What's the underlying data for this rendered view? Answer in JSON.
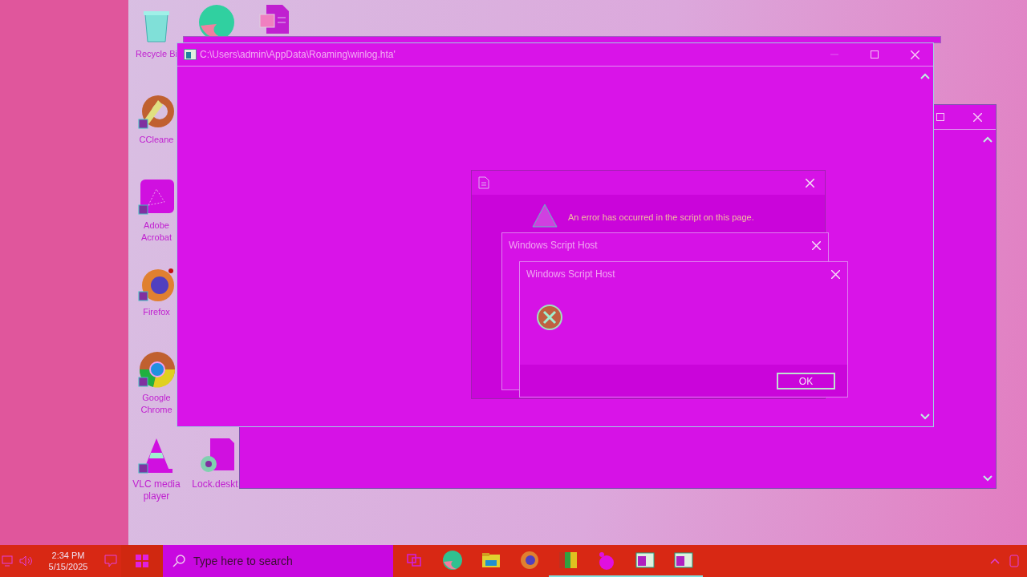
{
  "desktop_icons": [
    {
      "kind": "recycle",
      "label": "Recycle Bi"
    },
    {
      "kind": "edge"
    },
    {
      "kind": "word"
    },
    {
      "kind": "ccleaner",
      "label": "CCleane"
    },
    {
      "kind": "acrobat",
      "label": "Adobe Acrobat"
    },
    {
      "kind": "firefox",
      "label": "Firefox"
    },
    {
      "kind": "chrome",
      "label": "Google Chrome"
    },
    {
      "kind": "vlc",
      "label": "VLC media player"
    },
    {
      "kind": "file",
      "label": "Lock.deskt"
    }
  ],
  "back_window": {
    "buttons": [
      {
        "kind": "maximize",
        "disabled": false
      },
      {
        "kind": "close",
        "disabled": false
      }
    ]
  },
  "main_window": {
    "title": "C:\\Users\\admin\\AppData\\Roaming\\winlog.hta'",
    "buttons": [
      {
        "kind": "minimize",
        "disabled": true
      },
      {
        "kind": "maximize",
        "disabled": false
      },
      {
        "kind": "close",
        "disabled": false
      }
    ]
  },
  "dialogs": [
    {
      "kind": "script_error",
      "message": "An error has occurred in the script on this page."
    },
    {
      "kind": "host",
      "title": "Windows Script Host"
    },
    {
      "kind": "host_error",
      "title": "Windows Script Host",
      "button": "OK"
    }
  ],
  "taskbar": {
    "time": "2:34 PM",
    "date": "5/15/2025",
    "search": {
      "placeholder": "Type here to search"
    },
    "apps": [
      {
        "kind": "taskview",
        "running": false
      },
      {
        "kind": "edge",
        "running": false
      },
      {
        "kind": "folder",
        "running": false
      },
      {
        "kind": "firefox",
        "running": false
      },
      {
        "kind": "winrar",
        "running": true
      },
      {
        "kind": "app",
        "running": true
      },
      {
        "kind": "window",
        "running": true
      },
      {
        "kind": "window",
        "running": true
      }
    ]
  }
}
